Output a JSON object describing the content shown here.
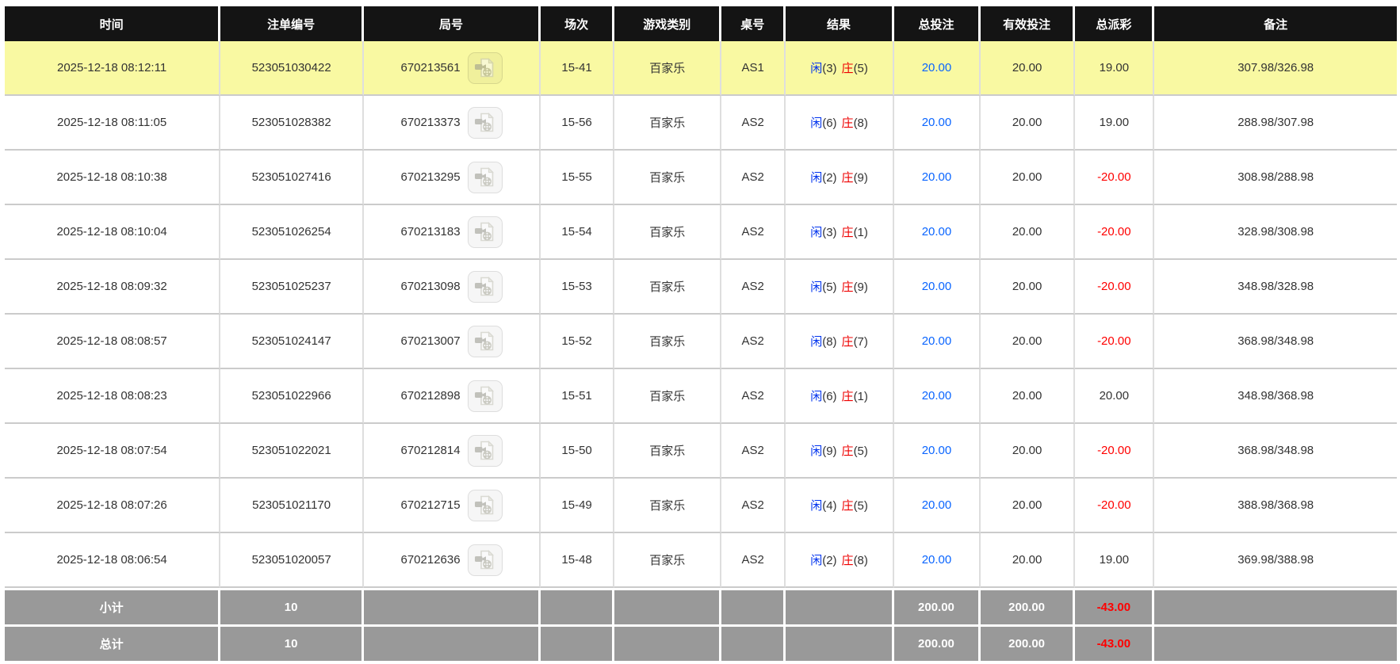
{
  "colors": {
    "header_bg": "#141414",
    "highlight_bg": "#f9f9a2",
    "footer_bg": "#999999",
    "player_blue": "#0033ee",
    "banker_red": "#ee0000",
    "bet_blue": "#0a65ff",
    "negative_red": "#ff0000",
    "row_text": "#333333"
  },
  "icons": {
    "video_replay": "video-replay-icon"
  },
  "table": {
    "columns": [
      {
        "key": "time",
        "label": "时间"
      },
      {
        "key": "bet_id",
        "label": "注单编号"
      },
      {
        "key": "round_id",
        "label": "局号"
      },
      {
        "key": "session",
        "label": "场次"
      },
      {
        "key": "game_type",
        "label": "游戏类别"
      },
      {
        "key": "table_id",
        "label": "桌号"
      },
      {
        "key": "result",
        "label": "结果"
      },
      {
        "key": "total_bet",
        "label": "总投注"
      },
      {
        "key": "valid_bet",
        "label": "有效投注"
      },
      {
        "key": "payout",
        "label": "总派彩"
      },
      {
        "key": "remark",
        "label": "备注"
      }
    ],
    "rows": [
      {
        "time": "2025-12-18 08:12:11",
        "bet_id": "523051030422",
        "round_id": "670213561",
        "session": "15-41",
        "game_type": "百家乐",
        "table_id": "AS1",
        "result": {
          "player": "闲",
          "player_score": "(3)",
          "banker": "庄",
          "banker_score": "(5)"
        },
        "total_bet": "20.00",
        "valid_bet": "20.00",
        "payout": "19.00",
        "remark": "307.98/326.98",
        "highlighted": true
      },
      {
        "time": "2025-12-18 08:11:05",
        "bet_id": "523051028382",
        "round_id": "670213373",
        "session": "15-56",
        "game_type": "百家乐",
        "table_id": "AS2",
        "result": {
          "player": "闲",
          "player_score": "(6)",
          "banker": "庄",
          "banker_score": "(8)"
        },
        "total_bet": "20.00",
        "valid_bet": "20.00",
        "payout": "19.00",
        "remark": "288.98/307.98",
        "highlighted": false
      },
      {
        "time": "2025-12-18 08:10:38",
        "bet_id": "523051027416",
        "round_id": "670213295",
        "session": "15-55",
        "game_type": "百家乐",
        "table_id": "AS2",
        "result": {
          "player": "闲",
          "player_score": "(2)",
          "banker": "庄",
          "banker_score": "(9)"
        },
        "total_bet": "20.00",
        "valid_bet": "20.00",
        "payout": "-20.00",
        "remark": "308.98/288.98",
        "highlighted": false
      },
      {
        "time": "2025-12-18 08:10:04",
        "bet_id": "523051026254",
        "round_id": "670213183",
        "session": "15-54",
        "game_type": "百家乐",
        "table_id": "AS2",
        "result": {
          "player": "闲",
          "player_score": "(3)",
          "banker": "庄",
          "banker_score": "(1)"
        },
        "total_bet": "20.00",
        "valid_bet": "20.00",
        "payout": "-20.00",
        "remark": "328.98/308.98",
        "highlighted": false
      },
      {
        "time": "2025-12-18 08:09:32",
        "bet_id": "523051025237",
        "round_id": "670213098",
        "session": "15-53",
        "game_type": "百家乐",
        "table_id": "AS2",
        "result": {
          "player": "闲",
          "player_score": "(5)",
          "banker": "庄",
          "banker_score": "(9)"
        },
        "total_bet": "20.00",
        "valid_bet": "20.00",
        "payout": "-20.00",
        "remark": "348.98/328.98",
        "highlighted": false
      },
      {
        "time": "2025-12-18 08:08:57",
        "bet_id": "523051024147",
        "round_id": "670213007",
        "session": "15-52",
        "game_type": "百家乐",
        "table_id": "AS2",
        "result": {
          "player": "闲",
          "player_score": "(8)",
          "banker": "庄",
          "banker_score": "(7)"
        },
        "total_bet": "20.00",
        "valid_bet": "20.00",
        "payout": "-20.00",
        "remark": "368.98/348.98",
        "highlighted": false
      },
      {
        "time": "2025-12-18 08:08:23",
        "bet_id": "523051022966",
        "round_id": "670212898",
        "session": "15-51",
        "game_type": "百家乐",
        "table_id": "AS2",
        "result": {
          "player": "闲",
          "player_score": "(6)",
          "banker": "庄",
          "banker_score": "(1)"
        },
        "total_bet": "20.00",
        "valid_bet": "20.00",
        "payout": "20.00",
        "remark": "348.98/368.98",
        "highlighted": false
      },
      {
        "time": "2025-12-18 08:07:54",
        "bet_id": "523051022021",
        "round_id": "670212814",
        "session": "15-50",
        "game_type": "百家乐",
        "table_id": "AS2",
        "result": {
          "player": "闲",
          "player_score": "(9)",
          "banker": "庄",
          "banker_score": "(5)"
        },
        "total_bet": "20.00",
        "valid_bet": "20.00",
        "payout": "-20.00",
        "remark": "368.98/348.98",
        "highlighted": false
      },
      {
        "time": "2025-12-18 08:07:26",
        "bet_id": "523051021170",
        "round_id": "670212715",
        "session": "15-49",
        "game_type": "百家乐",
        "table_id": "AS2",
        "result": {
          "player": "闲",
          "player_score": "(4)",
          "banker": "庄",
          "banker_score": "(5)"
        },
        "total_bet": "20.00",
        "valid_bet": "20.00",
        "payout": "-20.00",
        "remark": "388.98/368.98",
        "highlighted": false
      },
      {
        "time": "2025-12-18 08:06:54",
        "bet_id": "523051020057",
        "round_id": "670212636",
        "session": "15-48",
        "game_type": "百家乐",
        "table_id": "AS2",
        "result": {
          "player": "闲",
          "player_score": "(2)",
          "banker": "庄",
          "banker_score": "(8)"
        },
        "total_bet": "20.00",
        "valid_bet": "20.00",
        "payout": "19.00",
        "remark": "369.98/388.98",
        "highlighted": false
      }
    ],
    "footer_rows": [
      {
        "key": "subtotal",
        "label": "小计",
        "count": "10",
        "total_bet": "200.00",
        "valid_bet": "200.00",
        "payout": "-43.00",
        "remark": ""
      },
      {
        "key": "total",
        "label": "总计",
        "count": "10",
        "total_bet": "200.00",
        "valid_bet": "200.00",
        "payout": "-43.00",
        "remark": ""
      }
    ]
  }
}
